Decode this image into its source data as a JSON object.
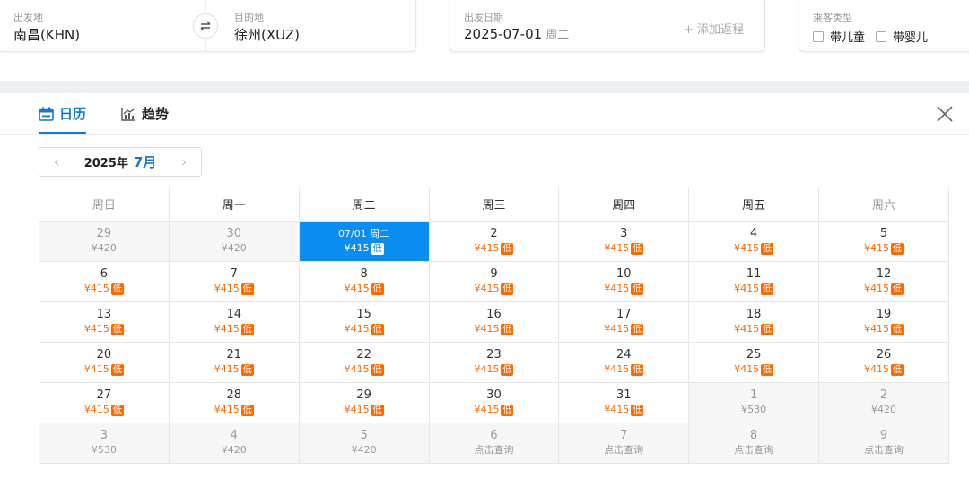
{
  "search": {
    "origin_label": "出发地",
    "origin_value": "南昌(KHN)",
    "destination_label": "目的地",
    "destination_value": "徐州(XUZ)",
    "date_label": "出发日期",
    "date_value": "2025-07-01",
    "date_weekday": "周二",
    "return_label": "+ 添加返程",
    "passenger_label": "乘客类型",
    "child_label": "带儿童",
    "infant_label": "带婴儿"
  },
  "tabs": {
    "calendar": "日历",
    "trend": "趋势"
  },
  "nav": {
    "year": "2025年",
    "month": "7月"
  },
  "weekdays": [
    "周日",
    "周一",
    "周二",
    "周三",
    "周四",
    "周五",
    "周六"
  ],
  "low_badge": "低",
  "colors": {
    "accent": "#1677d2",
    "selected": "#0a8cf0",
    "price": "#ff6a00"
  },
  "weeks": [
    [
      {
        "day": "29",
        "price": "¥420",
        "kind": "past"
      },
      {
        "day": "30",
        "price": "¥420",
        "kind": "past"
      },
      {
        "day": "07/01 周二",
        "price": "¥415",
        "low": true,
        "kind": "sel"
      },
      {
        "day": "2",
        "price": "¥415",
        "low": true
      },
      {
        "day": "3",
        "price": "¥415",
        "low": true
      },
      {
        "day": "4",
        "price": "¥415",
        "low": true
      },
      {
        "day": "5",
        "price": "¥415",
        "low": true
      }
    ],
    [
      {
        "day": "6",
        "price": "¥415",
        "low": true
      },
      {
        "day": "7",
        "price": "¥415",
        "low": true
      },
      {
        "day": "8",
        "price": "¥415",
        "low": true
      },
      {
        "day": "9",
        "price": "¥415",
        "low": true
      },
      {
        "day": "10",
        "price": "¥415",
        "low": true
      },
      {
        "day": "11",
        "price": "¥415",
        "low": true
      },
      {
        "day": "12",
        "price": "¥415",
        "low": true
      }
    ],
    [
      {
        "day": "13",
        "price": "¥415",
        "low": true
      },
      {
        "day": "14",
        "price": "¥415",
        "low": true
      },
      {
        "day": "15",
        "price": "¥415",
        "low": true
      },
      {
        "day": "16",
        "price": "¥415",
        "low": true
      },
      {
        "day": "17",
        "price": "¥415",
        "low": true
      },
      {
        "day": "18",
        "price": "¥415",
        "low": true
      },
      {
        "day": "19",
        "price": "¥415",
        "low": true
      }
    ],
    [
      {
        "day": "20",
        "price": "¥415",
        "low": true
      },
      {
        "day": "21",
        "price": "¥415",
        "low": true
      },
      {
        "day": "22",
        "price": "¥415",
        "low": true
      },
      {
        "day": "23",
        "price": "¥415",
        "low": true
      },
      {
        "day": "24",
        "price": "¥415",
        "low": true
      },
      {
        "day": "25",
        "price": "¥415",
        "low": true
      },
      {
        "day": "26",
        "price": "¥415",
        "low": true
      }
    ],
    [
      {
        "day": "27",
        "price": "¥415",
        "low": true
      },
      {
        "day": "28",
        "price": "¥415",
        "low": true
      },
      {
        "day": "29",
        "price": "¥415",
        "low": true
      },
      {
        "day": "30",
        "price": "¥415",
        "low": true
      },
      {
        "day": "31",
        "price": "¥415",
        "low": true
      },
      {
        "day": "1",
        "price": "¥530",
        "kind": "next"
      },
      {
        "day": "2",
        "price": "¥420",
        "kind": "next"
      }
    ],
    [
      {
        "day": "3",
        "price": "¥530",
        "kind": "next"
      },
      {
        "day": "4",
        "price": "¥420",
        "kind": "next"
      },
      {
        "day": "5",
        "price": "¥420",
        "kind": "next"
      },
      {
        "day": "6",
        "query": "点击查询",
        "kind": "next"
      },
      {
        "day": "7",
        "query": "点击查询",
        "kind": "next"
      },
      {
        "day": "8",
        "query": "点击查询",
        "kind": "next"
      },
      {
        "day": "9",
        "query": "点击查询",
        "kind": "next"
      }
    ]
  ]
}
